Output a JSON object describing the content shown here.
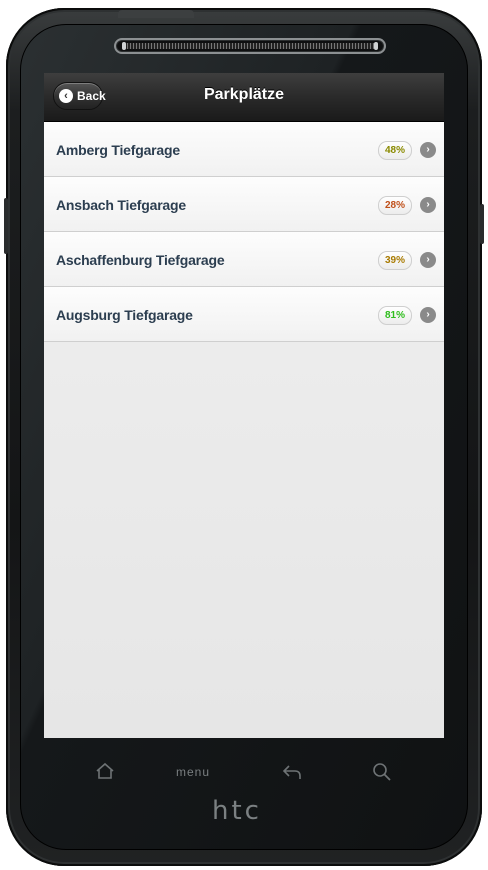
{
  "header": {
    "title": "Parkplätze",
    "back_label": "Back"
  },
  "list": [
    {
      "name": "Amberg Tiefgarage",
      "occupancy": "48%",
      "color": "#8a8a00"
    },
    {
      "name": "Ansbach Tiefgarage",
      "occupancy": "28%",
      "color": "#c0501a"
    },
    {
      "name": "Aschaffenburg Tiefgarage",
      "occupancy": "39%",
      "color": "#a87a00"
    },
    {
      "name": "Augsburg Tiefgarage",
      "occupancy": "81%",
      "color": "#2ebd1c"
    }
  ],
  "device": {
    "menu_label": "menu",
    "logo": "htc",
    "keys": [
      "home-icon",
      "menu",
      "back-arrow-icon",
      "search-icon"
    ]
  }
}
